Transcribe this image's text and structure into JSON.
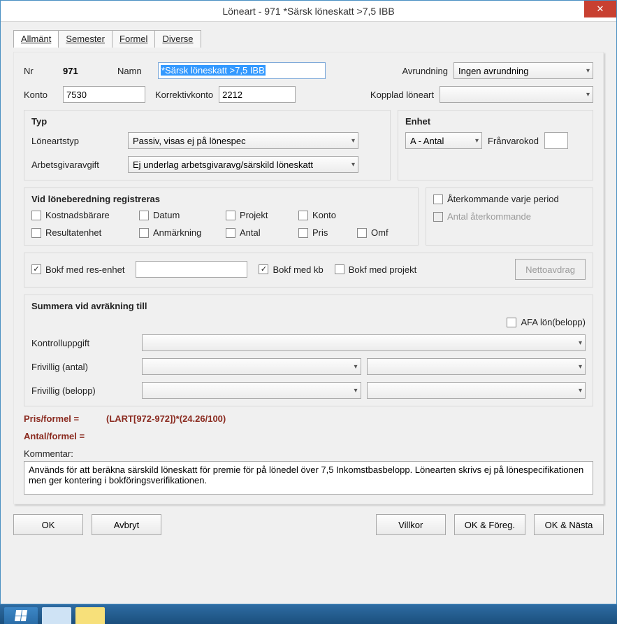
{
  "window": {
    "title": "Löneart - 971  *Särsk löneskatt >7,5 IBB",
    "close": "✕"
  },
  "tabs": {
    "allmant": "Allmänt",
    "semester": "Semester",
    "formel": "Formel",
    "diverse": "Diverse"
  },
  "top": {
    "nr_label": "Nr",
    "nr_value": "971",
    "namn_label": "Namn",
    "namn_value": "*Särsk löneskatt >7,5 IBB",
    "avrundning_label": "Avrundning",
    "avrundning_value": "Ingen avrundning",
    "konto_label": "Konto",
    "konto_value": "7530",
    "korrkonto_label": "Korrektivkonto",
    "korrkonto_value": "2212",
    "kopplad_label": "Kopplad löneart",
    "kopplad_value": ""
  },
  "typ": {
    "title": "Typ",
    "loneartstyp_label": "Löneartstyp",
    "loneartstyp_value": "Passiv, visas ej på lönespec",
    "arbetsgivaravgift_label": "Arbetsgivaravgift",
    "arbetsgivaravgift_value": "Ej underlag arbetsgivaravg/särskild löneskatt"
  },
  "enhet": {
    "title": "Enhet",
    "value": "A - Antal",
    "franvarokod_label": "Frånvarokod",
    "franvarokod_value": ""
  },
  "vid": {
    "title": "Vid löneberedning registreras",
    "kostnadsbarare": "Kostnadsbärare",
    "datum": "Datum",
    "projekt": "Projekt",
    "konto": "Konto",
    "resultatenhet": "Resultatenhet",
    "anmarkning": "Anmärkning",
    "antal": "Antal",
    "pris": "Pris",
    "omf": "Omf",
    "aterkommande": "Återkommande varje period",
    "antal_aterkommande": "Antal återkommande"
  },
  "bokf": {
    "res_enhet": "Bokf med res-enhet",
    "res_enhet_value": "",
    "kb": "Bokf med kb",
    "projekt": "Bokf med projekt",
    "nettoavdrag": "Nettoavdrag"
  },
  "summera": {
    "title": "Summera vid avräkning till",
    "afa": "AFA lön(belopp)",
    "kontrolluppgift_label": "Kontrolluppgift",
    "frivillig_antal_label": "Frivillig (antal)",
    "frivillig_belopp_label": "Frivillig (belopp)"
  },
  "formel_row": {
    "pris_label": "Pris/formel =",
    "pris_value": "(LART[972-972])*(24.26/100)",
    "antal_label": "Antal/formel ="
  },
  "kommentar": {
    "label": "Kommentar:",
    "value": "Används för att beräkna särskild löneskatt för premie för på lönedel över 7,5 Inkomstbasbelopp. Lönearten skrivs ej på lönespecifikationen men ger kontering i bokföringsverifikationen."
  },
  "buttons": {
    "ok": "OK",
    "avbryt": "Avbryt",
    "villkor": "Villkor",
    "ok_foreg": "OK & Föreg.",
    "ok_nasta": "OK & Nästa"
  }
}
